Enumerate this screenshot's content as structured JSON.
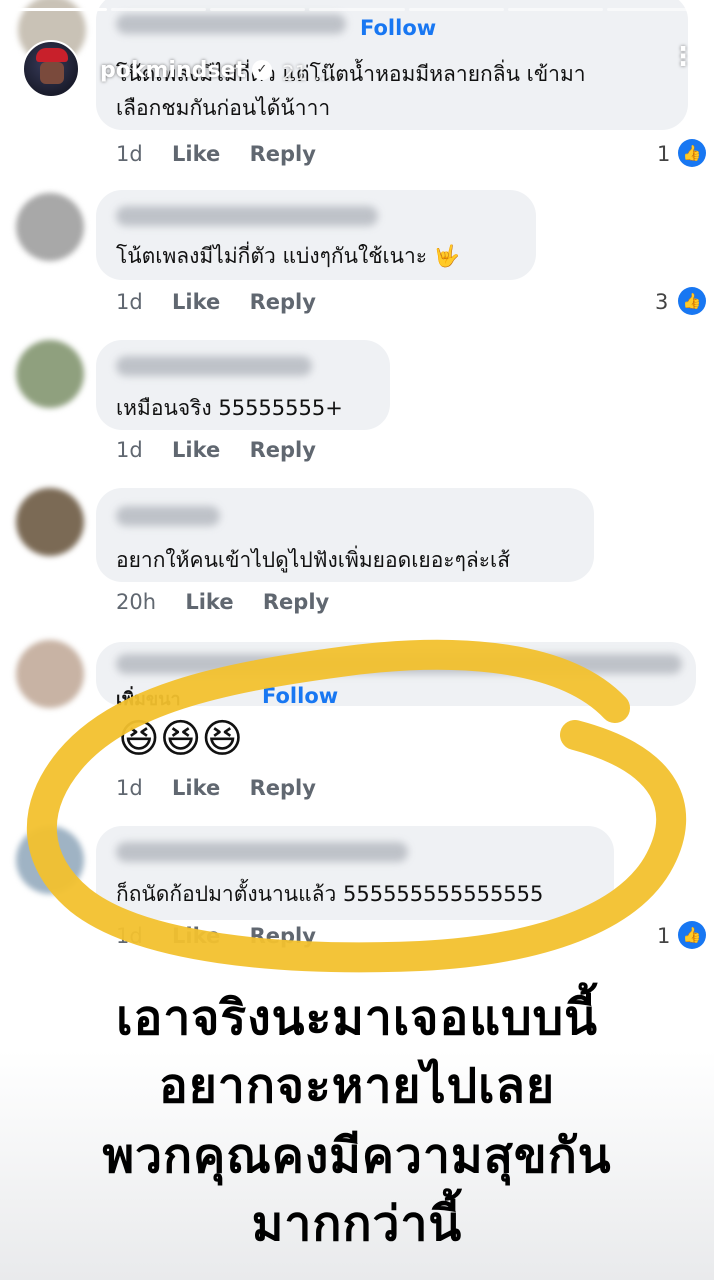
{
  "story": {
    "username": "pokmindset",
    "time": "21 ...",
    "more_label": "⋮"
  },
  "comments": [
    {
      "text_line1": "โน๊ตเพลงมีไม่กี่ตัว แต่โน๊ตน้ำหอมมีหลายกลิ่น เข้ามา",
      "text_line2": "เลือกชมกันก่อนได้น้าาา",
      "follow": "Follow",
      "time": "1d",
      "like": "Like",
      "reply": "Reply",
      "reactions": "1"
    },
    {
      "text": "โน้ตเพลงมีไม่กี่ตัว แบ่งๆกันใช้เนาะ 🤟",
      "time": "1d",
      "like": "Like",
      "reply": "Reply",
      "reactions": "3"
    },
    {
      "text": "เหมือนจริง 55555555+",
      "time": "1d",
      "like": "Like",
      "reply": "Reply"
    },
    {
      "text": "อยากให้คนเข้าไปดูไปฟังเพิ่มยอดเยอะๆล่ะเส้",
      "time": "20h",
      "like": "Like",
      "reply": "Reply"
    },
    {
      "text": "เพิ่มขนา",
      "follow": "Follow",
      "emoji": "😆😆😆",
      "time": "1d",
      "like": "Like",
      "reply": "Reply"
    },
    {
      "text": "ก็ถนัดก้อปมาตั้งนานแล้ว 555555555555555",
      "time": "1d",
      "like": "Like",
      "reply": "Reply",
      "reactions": "1"
    }
  ],
  "caption": {
    "line1": "เอาจริงนะมาเจอแบบนี้",
    "line2": "อยากจะหายไปเลย",
    "line3": "พวกคุณคงมีความสุขกัน",
    "line4": "มากกว่านี้"
  },
  "colors": {
    "annotation": "#f2c12e",
    "link": "#1877f2",
    "bubble": "#eff1f4"
  },
  "icons": {
    "like_badge": "thumbs-up-icon",
    "verified": "verified-badge-icon"
  }
}
